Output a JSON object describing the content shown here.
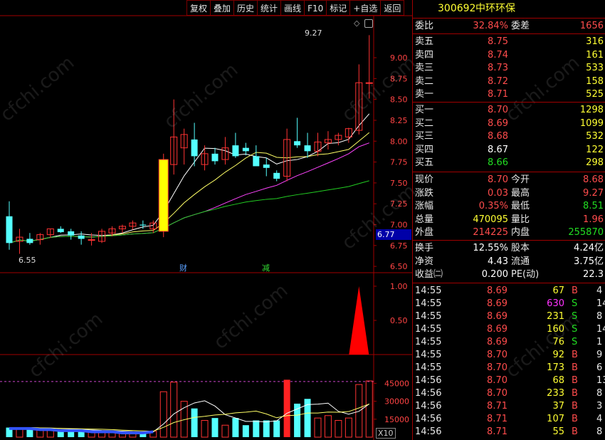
{
  "toolbar": {
    "buttons": [
      "复权",
      "叠加",
      "历史",
      "统计",
      "画线",
      "F10",
      "标记",
      "+自选",
      "返回"
    ]
  },
  "stock": {
    "code": "300692",
    "name": "中环环保"
  },
  "watermark": "cfchi.com",
  "price_axis": {
    "ticks": [
      "9.00",
      "8.75",
      "8.50",
      "8.25",
      "8.00",
      "7.75",
      "7.50",
      "7.25",
      "7.00",
      "6.75",
      "6.50"
    ],
    "current_price": "6.77",
    "high_marker": "9.27",
    "low_marker": "6.55"
  },
  "event_markers": {
    "finance": "财",
    "reduce": "减"
  },
  "indicator_axis": {
    "ticks": [
      "1.00",
      "0.50"
    ]
  },
  "volume_axis": {
    "ticks": [
      "45000",
      "30000",
      "15000"
    ],
    "multiplier": "X10"
  },
  "chart_data": {
    "type": "candlestick",
    "title": "",
    "ylim": [
      6.45,
      9.35
    ],
    "candles": [
      {
        "o": 7.1,
        "h": 7.28,
        "l": 6.7,
        "c": 6.78
      },
      {
        "o": 6.8,
        "h": 6.95,
        "l": 6.65,
        "c": 6.85
      },
      {
        "o": 6.83,
        "h": 6.9,
        "l": 6.76,
        "c": 6.78
      },
      {
        "o": 6.82,
        "h": 6.9,
        "l": 6.76,
        "c": 6.88
      },
      {
        "o": 6.88,
        "h": 6.95,
        "l": 6.84,
        "c": 6.95
      },
      {
        "o": 6.95,
        "h": 6.98,
        "l": 6.9,
        "c": 6.91
      },
      {
        "o": 6.92,
        "h": 6.95,
        "l": 6.82,
        "c": 6.87
      },
      {
        "o": 6.87,
        "h": 6.92,
        "l": 6.76,
        "c": 6.83
      },
      {
        "o": 6.82,
        "h": 6.9,
        "l": 6.75,
        "c": 6.82
      },
      {
        "o": 6.8,
        "h": 6.95,
        "l": 6.78,
        "c": 6.92
      },
      {
        "o": 6.9,
        "h": 6.98,
        "l": 6.86,
        "c": 6.95
      },
      {
        "o": 6.95,
        "h": 7.0,
        "l": 6.9,
        "c": 6.98
      },
      {
        "o": 6.98,
        "h": 7.05,
        "l": 6.94,
        "c": 7.02
      },
      {
        "o": 7.0,
        "h": 7.05,
        "l": 6.95,
        "c": 6.99
      },
      {
        "o": 6.95,
        "h": 7.05,
        "l": 6.9,
        "c": 7.02
      },
      {
        "o": 6.92,
        "h": 7.85,
        "l": 6.85,
        "c": 7.78
      },
      {
        "o": 7.72,
        "h": 8.5,
        "l": 7.6,
        "c": 8.05
      },
      {
        "o": 7.92,
        "h": 8.15,
        "l": 7.72,
        "c": 8.08
      },
      {
        "o": 8.02,
        "h": 8.22,
        "l": 7.7,
        "c": 7.82
      },
      {
        "o": 7.72,
        "h": 7.95,
        "l": 7.65,
        "c": 7.85
      },
      {
        "o": 7.85,
        "h": 7.92,
        "l": 7.72,
        "c": 7.76
      },
      {
        "o": 7.78,
        "h": 8.05,
        "l": 7.72,
        "c": 7.92
      },
      {
        "o": 7.95,
        "h": 8.1,
        "l": 7.8,
        "c": 7.82
      },
      {
        "o": 7.92,
        "h": 7.98,
        "l": 7.83,
        "c": 7.88
      },
      {
        "o": 7.82,
        "h": 7.95,
        "l": 7.72,
        "c": 7.7
      },
      {
        "o": 7.72,
        "h": 7.8,
        "l": 7.58,
        "c": 7.68
      },
      {
        "o": 7.62,
        "h": 7.65,
        "l": 7.52,
        "c": 7.55
      },
      {
        "o": 7.58,
        "h": 8.15,
        "l": 7.52,
        "c": 8.02
      },
      {
        "o": 8.0,
        "h": 8.28,
        "l": 7.92,
        "c": 7.95
      },
      {
        "o": 7.95,
        "h": 8.1,
        "l": 7.8,
        "c": 7.88
      },
      {
        "o": 7.88,
        "h": 8.1,
        "l": 7.82,
        "c": 7.99
      },
      {
        "o": 7.98,
        "h": 8.12,
        "l": 7.9,
        "c": 8.02
      },
      {
        "o": 8.02,
        "h": 8.1,
        "l": 7.95,
        "c": 8.07
      },
      {
        "o": 8.05,
        "h": 8.16,
        "l": 7.98,
        "c": 8.15
      },
      {
        "o": 8.13,
        "h": 8.92,
        "l": 8.08,
        "c": 8.7
      },
      {
        "o": 8.7,
        "h": 9.27,
        "l": 8.51,
        "c": 8.7
      }
    ],
    "volume": [
      8000,
      8000,
      8000,
      7000,
      7000,
      6000,
      6000,
      6000,
      5000,
      5000,
      5000,
      4000,
      4000,
      4000,
      5000,
      38000,
      46000,
      30000,
      24000,
      14000,
      16000,
      10000,
      16000,
      10000,
      14000,
      14000,
      14000,
      48000,
      28000,
      32000,
      16000,
      18000,
      14000,
      16000,
      44000,
      47000
    ],
    "signal": [
      0,
      0,
      0,
      0,
      0,
      0,
      0,
      0,
      0,
      0,
      0,
      0,
      0,
      0,
      0,
      0,
      0,
      0,
      0,
      0,
      0,
      0,
      0,
      0,
      0,
      0,
      0,
      0,
      0,
      0,
      0,
      0,
      0,
      0,
      1,
      0
    ]
  },
  "quote": {
    "weibi_label": "委比",
    "weibi": "32.84%",
    "weicha_label": "委差",
    "weicha": "1656",
    "asks": [
      {
        "label": "卖五",
        "price": "8.75",
        "vol": "316"
      },
      {
        "label": "卖四",
        "price": "8.74",
        "vol": "161"
      },
      {
        "label": "卖三",
        "price": "8.73",
        "vol": "533"
      },
      {
        "label": "卖二",
        "price": "8.72",
        "vol": "158"
      },
      {
        "label": "卖一",
        "price": "8.71",
        "vol": "525"
      }
    ],
    "bids": [
      {
        "label": "买一",
        "price": "8.70",
        "vol": "1298"
      },
      {
        "label": "买二",
        "price": "8.69",
        "vol": "1099"
      },
      {
        "label": "买三",
        "price": "8.68",
        "vol": "532"
      },
      {
        "label": "买四",
        "price": "8.67",
        "vol": "122"
      },
      {
        "label": "买五",
        "price": "8.66",
        "vol": "298"
      }
    ],
    "stats": [
      {
        "l1": "现价",
        "v1": "8.70",
        "l2": "今开",
        "v2": "8.68"
      },
      {
        "l1": "涨跌",
        "v1": "0.03",
        "l2": "最高",
        "v2": "9.27"
      },
      {
        "l1": "涨幅",
        "v1": "0.35%",
        "l2": "最低",
        "v2": "8.51"
      },
      {
        "l1": "总量",
        "v1": "470095",
        "l2": "量比",
        "v2": "1.96"
      },
      {
        "l1": "外盘",
        "v1": "214225",
        "l2": "内盘",
        "v2": "255870"
      }
    ],
    "fin": [
      {
        "l1": "换手",
        "v1": "12.55%",
        "l2": "股本",
        "v2": "4.24亿"
      },
      {
        "l1": "净资",
        "v1": "4.43",
        "l2": "流通",
        "v2": "3.75亿"
      },
      {
        "l1": "收益㈡",
        "v1": "0.200",
        "l2": "PE(动)",
        "v2": "22.3"
      }
    ]
  },
  "ticks": [
    {
      "time": "14:55",
      "price": "8.69",
      "vol": "67",
      "side": "B",
      "n": "4"
    },
    {
      "time": "14:55",
      "price": "8.69",
      "vol": "630",
      "side": "S",
      "n": "14"
    },
    {
      "time": "14:55",
      "price": "8.69",
      "vol": "231",
      "side": "S",
      "n": "8"
    },
    {
      "time": "14:55",
      "price": "8.69",
      "vol": "160",
      "side": "S",
      "n": "14"
    },
    {
      "time": "14:55",
      "price": "8.69",
      "vol": "76",
      "side": "S",
      "n": "1"
    },
    {
      "time": "14:55",
      "price": "8.70",
      "vol": "92",
      "side": "B",
      "n": "9"
    },
    {
      "time": "14:55",
      "price": "8.70",
      "vol": "173",
      "side": "B",
      "n": "6"
    },
    {
      "time": "14:56",
      "price": "8.70",
      "vol": "68",
      "side": "B",
      "n": "13"
    },
    {
      "time": "14:56",
      "price": "8.70",
      "vol": "233",
      "side": "B",
      "n": "8"
    },
    {
      "time": "14:56",
      "price": "8.71",
      "vol": "37",
      "side": "B",
      "n": "3"
    },
    {
      "time": "14:56",
      "price": "8.71",
      "vol": "107",
      "side": "B",
      "n": "4"
    },
    {
      "time": "14:56",
      "price": "8.71",
      "vol": "55",
      "side": "B",
      "n": "8"
    }
  ],
  "colors": {
    "up": "#ff3333",
    "down": "#54ffff",
    "grid": "#a00000",
    "limit_up": "#ffff00"
  }
}
